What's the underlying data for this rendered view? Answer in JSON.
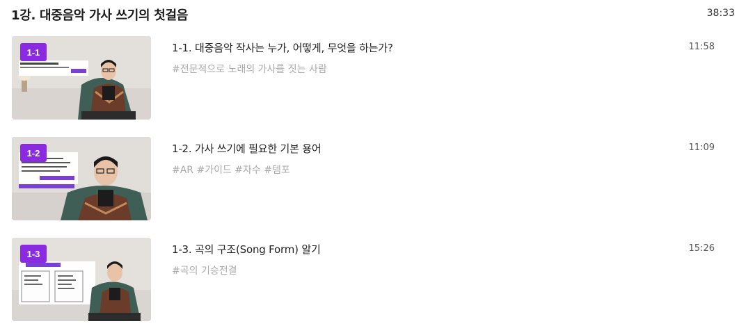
{
  "section": {
    "title": "1강. 대중음악 가사 쓰기의 첫걸음",
    "duration": "38:33"
  },
  "lessons": [
    {
      "badge": "1-1",
      "title": "1-1. 대중음악 작사는 누가, 어떻게, 무엇을 하는가?",
      "tags": "#전문적으로 노래의 가사를 짓는 사람",
      "duration": "11:58"
    },
    {
      "badge": "1-2",
      "title": "1-2. 가사 쓰기에 필요한 기본 용어",
      "tags": "#AR #가이드 #자수 #템포",
      "duration": "11:09"
    },
    {
      "badge": "1-3",
      "title": "1-3. 곡의 구조(Song Form) 알기",
      "tags": "#곡의 기승전결",
      "duration": "15:26"
    }
  ],
  "colors": {
    "badge": "#8a2be2",
    "tag": "#aaaaaa",
    "chair": "#3f5e55"
  },
  "icons": [
    "video-thumbnail"
  ]
}
